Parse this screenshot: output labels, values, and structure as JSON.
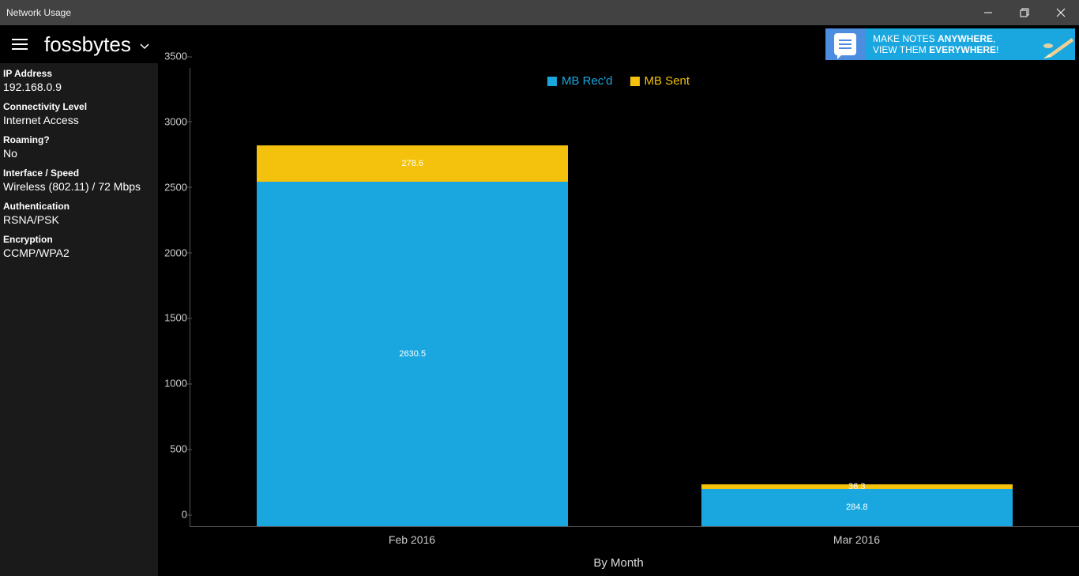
{
  "window": {
    "title": "Network Usage"
  },
  "header": {
    "app_name": "fossbytes"
  },
  "ad": {
    "line1_plain": "MAKE NOTES ",
    "line1_bold": "ANYWHERE",
    "line2_plain": "VIEW THEM ",
    "line2_bold": "EVERYWHERE"
  },
  "sidebar": {
    "items": [
      {
        "label": "IP Address",
        "value": "192.168.0.9"
      },
      {
        "label": "Connectivity Level",
        "value": "Internet Access"
      },
      {
        "label": "Roaming?",
        "value": "No"
      },
      {
        "label": "Interface / Speed",
        "value": "Wireless (802.11) / 72 Mbps"
      },
      {
        "label": "Authentication",
        "value": "RSNA/PSK"
      },
      {
        "label": "Encryption",
        "value": "CCMP/WPA2"
      }
    ]
  },
  "legend": {
    "recd": "MB Rec'd",
    "sent": "MB Sent"
  },
  "chart_data": {
    "type": "bar",
    "stacked": true,
    "title": "",
    "xlabel": "By Month",
    "ylabel": "",
    "ylim": [
      0,
      3500
    ],
    "yticks": [
      0,
      500,
      1000,
      1500,
      2000,
      2500,
      3000,
      3500
    ],
    "categories": [
      "Feb 2016",
      "Mar 2016"
    ],
    "series": [
      {
        "name": "MB Rec'd",
        "color": "#1aa7e0",
        "values": [
          2630.5,
          284.8
        ]
      },
      {
        "name": "MB Sent",
        "color": "#f4c20d",
        "values": [
          278.6,
          36.3
        ]
      }
    ]
  },
  "colors": {
    "recd": "#1aa7e0",
    "sent": "#f4c20d",
    "titlebar": "#424242",
    "sidebar": "#1a1a1a"
  }
}
